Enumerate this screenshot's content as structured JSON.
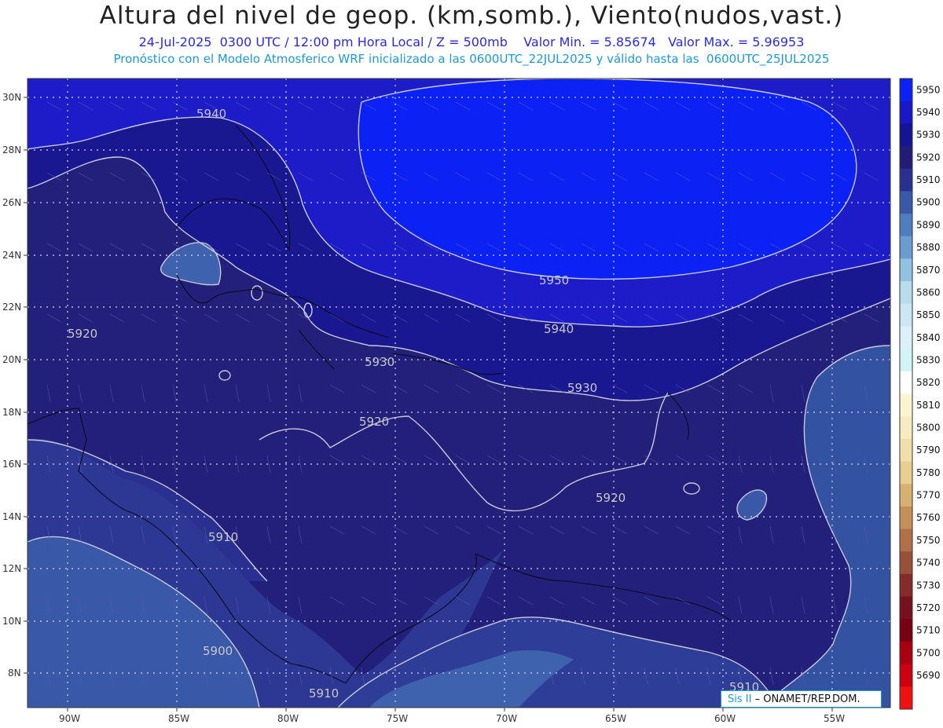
{
  "header": {
    "title": "Altura del nivel de geop. (km,somb.), Viento(nudos,vast.)",
    "subtitle": "24-Jul-2025  0300 UTC / 12:00 pm Hora Local / Z = 500mb    Valor Min. = 5.85674   Valor Max. = 5.96953",
    "subtitle2": "Pronóstico con el Modelo Atmosferico WRF inicializado a las 0600UTC_22JUL2025 y válido hasta las  0600UTC_25JUL2025"
  },
  "map": {
    "lat_labels": [
      "30N",
      "28N",
      "26N",
      "24N",
      "22N",
      "20N",
      "18N",
      "16N",
      "14N",
      "12N",
      "10N",
      "8N"
    ],
    "lon_labels": [
      "90W",
      "85W",
      "80W",
      "75W",
      "70W",
      "65W",
      "60W",
      "55W"
    ],
    "contour_labels": [
      "5940",
      "5950",
      "5940",
      "5930",
      "5930",
      "5920",
      "5920",
      "5920",
      "5910",
      "5900",
      "5910",
      "5910"
    ],
    "credit_lead": "Sis II",
    "credit_text": "– ONAMET/REP.DOM."
  },
  "colorbar": {
    "levels": [
      "5950",
      "5940",
      "5930",
      "5920",
      "5910",
      "5900",
      "5890",
      "5880",
      "5870",
      "5860",
      "5850",
      "5840",
      "5830",
      "5820",
      "5810",
      "5800",
      "5790",
      "5780",
      "5770",
      "5760",
      "5750",
      "5740",
      "5730",
      "5720",
      "5710",
      "5700",
      "5690"
    ],
    "colors": [
      "#0c22f5",
      "#1818c8",
      "#161496",
      "#221c78",
      "#2a3090",
      "#3a58a8",
      "#4f7ec0",
      "#6a9cd2",
      "#92c2e2",
      "#b6dcee",
      "#cce6f4",
      "#dcf0fa",
      "#d2f4f6",
      "#ffffff",
      "#fbf4d0",
      "#f6ecc0",
      "#f0dfaa",
      "#e8ce90",
      "#d8b070",
      "#c49058",
      "#b07048",
      "#98503a",
      "#862a2a",
      "#781020",
      "#7a0010",
      "#a80010",
      "#cc0010",
      "#f01010"
    ]
  }
}
